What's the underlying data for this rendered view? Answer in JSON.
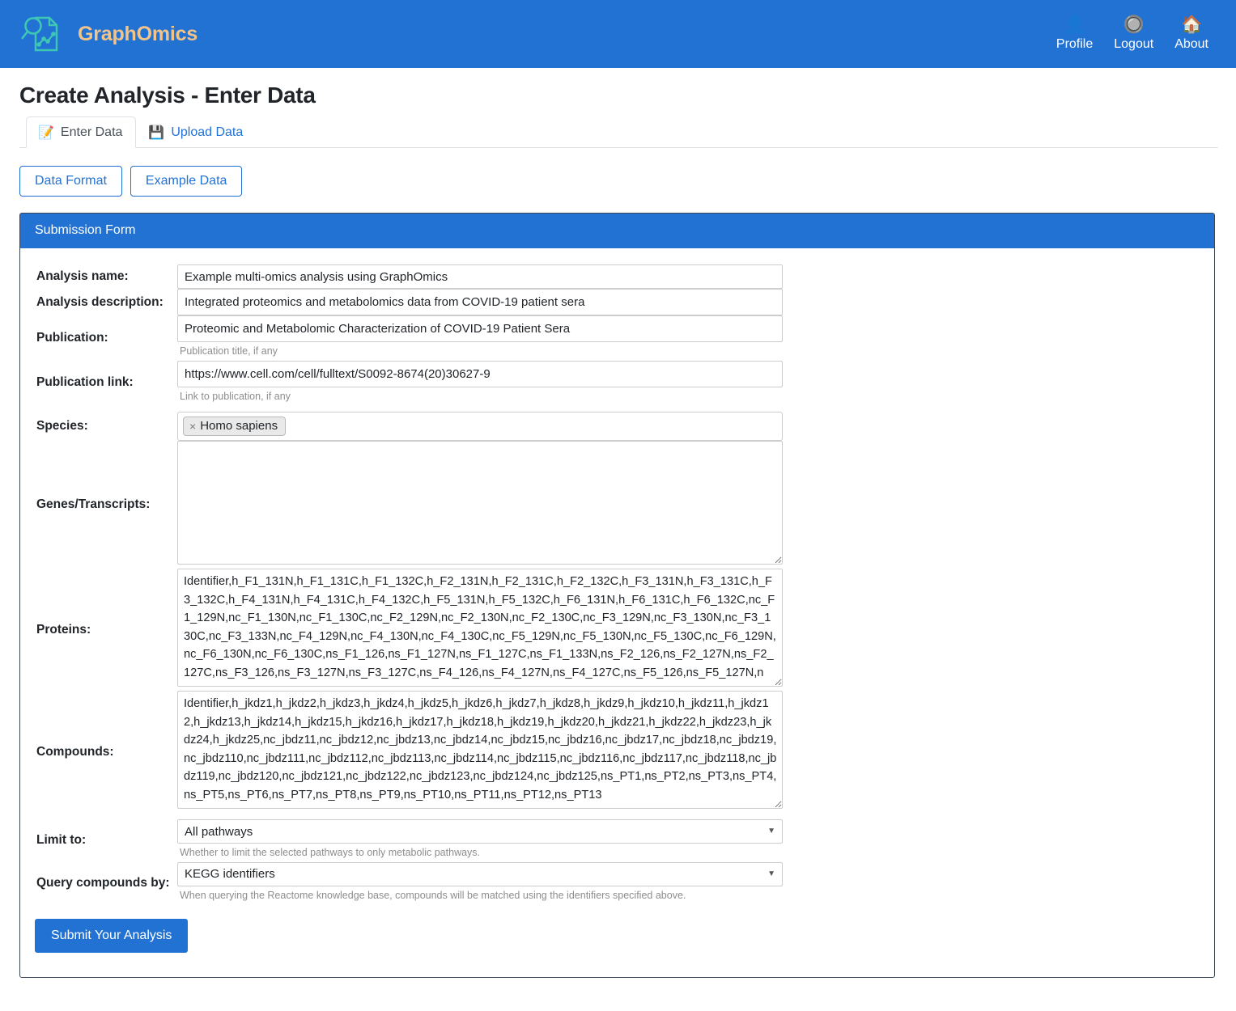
{
  "navbar": {
    "brand": "GraphOmics",
    "links": [
      {
        "label": "Profile",
        "icon": "👤"
      },
      {
        "label": "Logout",
        "icon": "🔘"
      },
      {
        "label": "About",
        "icon": "🏠"
      }
    ]
  },
  "page": {
    "title": "Create Analysis - Enter Data"
  },
  "tabs": [
    {
      "label": "Enter Data",
      "icon": "📝",
      "active": true
    },
    {
      "label": "Upload Data",
      "icon": "💾",
      "active": false
    }
  ],
  "buttons": {
    "data_format": "Data Format",
    "example_data": "Example Data",
    "submit": "Submit Your Analysis"
  },
  "form": {
    "header": "Submission Form",
    "labels": {
      "analysis_name": "Analysis name:",
      "analysis_description": "Analysis description:",
      "publication": "Publication:",
      "publication_link": "Publication link:",
      "species": "Species:",
      "genes": "Genes/Transcripts:",
      "proteins": "Proteins:",
      "compounds": "Compounds:",
      "limit_to": "Limit to:",
      "query_compounds_by": "Query compounds by:"
    },
    "values": {
      "analysis_name": "Example multi-omics analysis using GraphOmics",
      "analysis_description": "Integrated proteomics and metabolomics data from COVID-19 patient sera",
      "publication": "Proteomic and Metabolomic Characterization of COVID-19 Patient Sera",
      "publication_link": "https://www.cell.com/cell/fulltext/S0092-8674(20)30627-9",
      "species_tag": "Homo sapiens",
      "species_tag_remove": "×",
      "genes": "",
      "proteins": "Identifier,h_F1_131N,h_F1_131C,h_F1_132C,h_F2_131N,h_F2_131C,h_F2_132C,h_F3_131N,h_F3_131C,h_F3_132C,h_F4_131N,h_F4_131C,h_F4_132C,h_F5_131N,h_F5_132C,h_F6_131N,h_F6_131C,h_F6_132C,nc_F1_129N,nc_F1_130N,nc_F1_130C,nc_F2_129N,nc_F2_130N,nc_F2_130C,nc_F3_129N,nc_F3_130N,nc_F3_130C,nc_F3_133N,nc_F4_129N,nc_F4_130N,nc_F4_130C,nc_F5_129N,nc_F5_130N,nc_F5_130C,nc_F6_129N,nc_F6_130N,nc_F6_130C,ns_F1_126,ns_F1_127N,ns_F1_127C,ns_F1_133N,ns_F2_126,ns_F2_127N,ns_F2_127C,ns_F3_126,ns_F3_127N,ns_F3_127C,ns_F4_126,ns_F4_127N,ns_F4_127C,ns_F5_126,ns_F5_127N,n",
      "compounds": "Identifier,h_jkdz1,h_jkdz2,h_jkdz3,h_jkdz4,h_jkdz5,h_jkdz6,h_jkdz7,h_jkdz8,h_jkdz9,h_jkdz10,h_jkdz11,h_jkdz12,h_jkdz13,h_jkdz14,h_jkdz15,h_jkdz16,h_jkdz17,h_jkdz18,h_jkdz19,h_jkdz20,h_jkdz21,h_jkdz22,h_jkdz23,h_jkdz24,h_jkdz25,nc_jbdz11,nc_jbdz12,nc_jbdz13,nc_jbdz14,nc_jbdz15,nc_jbdz16,nc_jbdz17,nc_jbdz18,nc_jbdz19,nc_jbdz110,nc_jbdz111,nc_jbdz112,nc_jbdz113,nc_jbdz114,nc_jbdz115,nc_jbdz116,nc_jbdz117,nc_jbdz118,nc_jbdz119,nc_jbdz120,nc_jbdz121,nc_jbdz122,nc_jbdz123,nc_jbdz124,nc_jbdz125,ns_PT1,ns_PT2,ns_PT3,ns_PT4,ns_PT5,ns_PT6,ns_PT7,ns_PT8,ns_PT9,ns_PT10,ns_PT11,ns_PT12,ns_PT13",
      "limit_to": "All pathways",
      "query_compounds_by": "KEGG identifiers"
    },
    "help": {
      "publication": "Publication title, if any",
      "publication_link": "Link to publication, if any",
      "limit_to": "Whether to limit the selected pathways to only metabolic pathways.",
      "query_compounds_by": "When querying the Reactome knowledge base, compounds will be matched using the identifiers specified above."
    },
    "options": {
      "limit_to": [
        "All pathways"
      ],
      "query_compounds_by": [
        "KEGG identifiers"
      ]
    }
  },
  "colors": {
    "brand_blue": "#2272d4",
    "brand_name": "#f0c48a",
    "logo_teal": "#3ec8b4"
  }
}
